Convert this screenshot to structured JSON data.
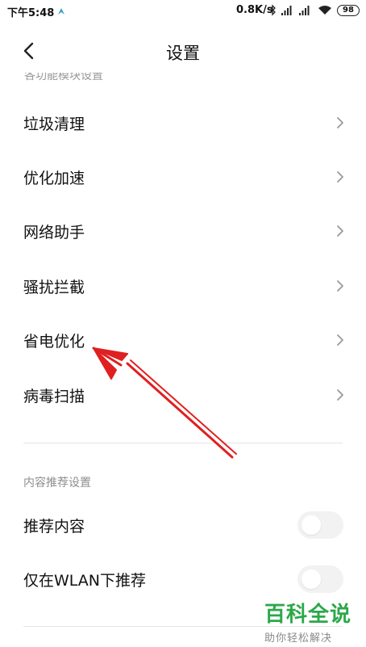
{
  "status_bar": {
    "time": "下午5:48",
    "network_speed": "0.8K/s",
    "battery": "98"
  },
  "header": {
    "title": "设置"
  },
  "sections": {
    "module_settings_title": "各功能模块设置",
    "content_settings_title": "内容推荐设置"
  },
  "module_items": [
    {
      "label": "垃圾清理"
    },
    {
      "label": "优化加速"
    },
    {
      "label": "网络助手"
    },
    {
      "label": "骚扰拦截"
    },
    {
      "label": "省电优化"
    },
    {
      "label": "病毒扫描"
    }
  ],
  "content_items": [
    {
      "label": "推荐内容",
      "enabled": false
    },
    {
      "label": "仅在WLAN下推荐",
      "enabled": false
    }
  ],
  "annotation": {
    "color": "#e02020"
  },
  "watermark": {
    "logo_text": "百科全说",
    "subtitle": "助你轻松解决"
  }
}
